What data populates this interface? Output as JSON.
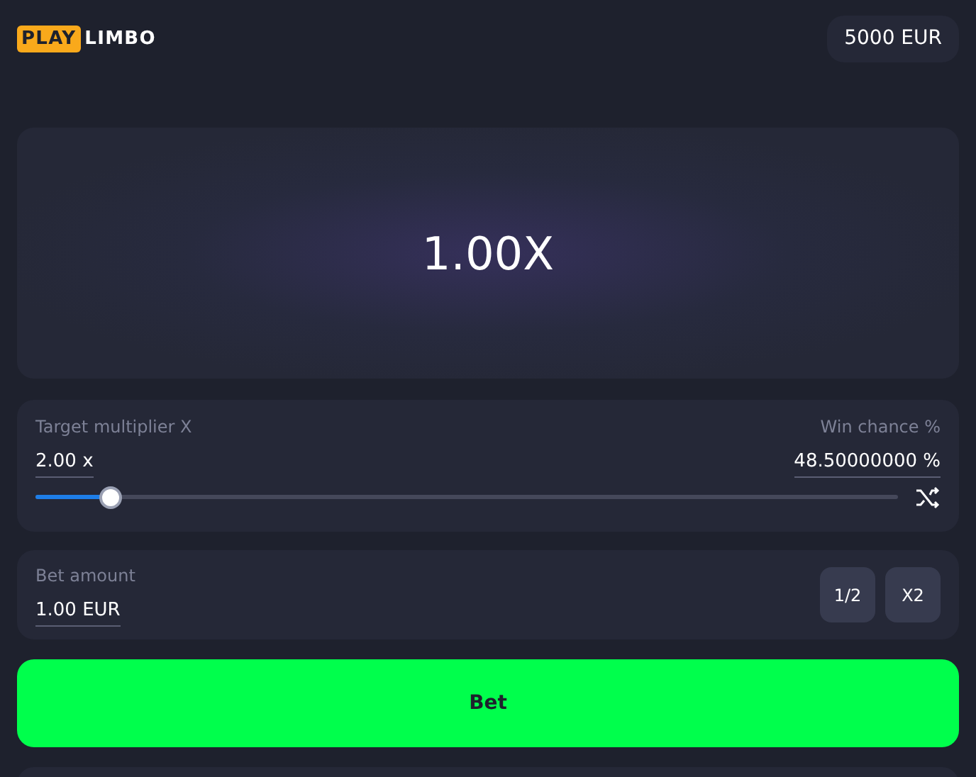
{
  "logo": {
    "badge": "PLAY",
    "name": "LIMBO"
  },
  "balance": "5000 EUR",
  "multiplier_display": "1.00X",
  "target": {
    "label": "Target multiplier X",
    "value": "2.00 x",
    "win_label": "Win chance %",
    "win_value": "48.50000000 %",
    "level": 0.087
  },
  "bet": {
    "label": "Bet amount",
    "value": "1.00 EUR",
    "buttons": [
      "1/2",
      "X2"
    ]
  },
  "bet_button": "Bet"
}
